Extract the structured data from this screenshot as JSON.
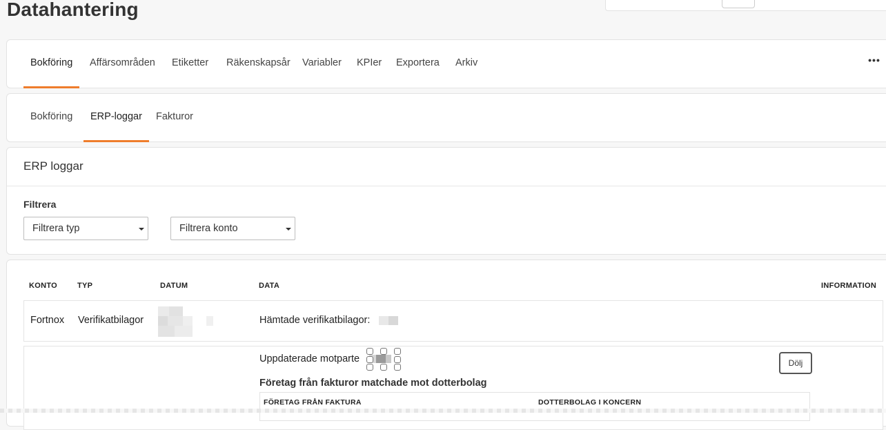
{
  "page": {
    "title": "Datahantering"
  },
  "main_tabs": [
    {
      "label": "Bokföring",
      "active": true
    },
    {
      "label": "Affärsområden"
    },
    {
      "label": "Etiketter"
    },
    {
      "label": "Räkenskapsår"
    },
    {
      "label": "Variabler"
    },
    {
      "label": "KPIer"
    },
    {
      "label": "Exportera"
    },
    {
      "label": "Arkiv"
    }
  ],
  "more_menu": {
    "icon": "ellipsis-icon",
    "glyph": "•••"
  },
  "sub_tabs": [
    {
      "label": "Bokföring"
    },
    {
      "label": "ERP-loggar",
      "active": true
    },
    {
      "label": "Fakturor"
    }
  ],
  "erp": {
    "title": "ERP loggar",
    "filter_label": "Filtrera",
    "filter_type": {
      "placeholder": "Filtrera typ"
    },
    "filter_account": {
      "placeholder": "Filtrera konto"
    }
  },
  "table": {
    "headers": {
      "konto": "KONTO",
      "typ": "TYP",
      "datum": "DATUM",
      "data": "DATA",
      "information": "INFORMATION"
    },
    "rows": [
      {
        "konto": "Fortnox",
        "typ": "Verifikatbilagor",
        "data": "Hämtade verifikatbilagor:"
      },
      {
        "data": "Uppdaterade motparte",
        "hide_button": "Dölj",
        "matched_title": "Företag från fakturor matchade mot dotterbolag",
        "sub_headers": {
          "from_invoice": "FÖRETAG FRÅN FAKTURA",
          "subsidiary": "DOTTERBOLAG I KONCERN"
        }
      }
    ]
  },
  "colors": {
    "accent": "#ef7d2c",
    "page_bg": "#f7f7f7"
  }
}
